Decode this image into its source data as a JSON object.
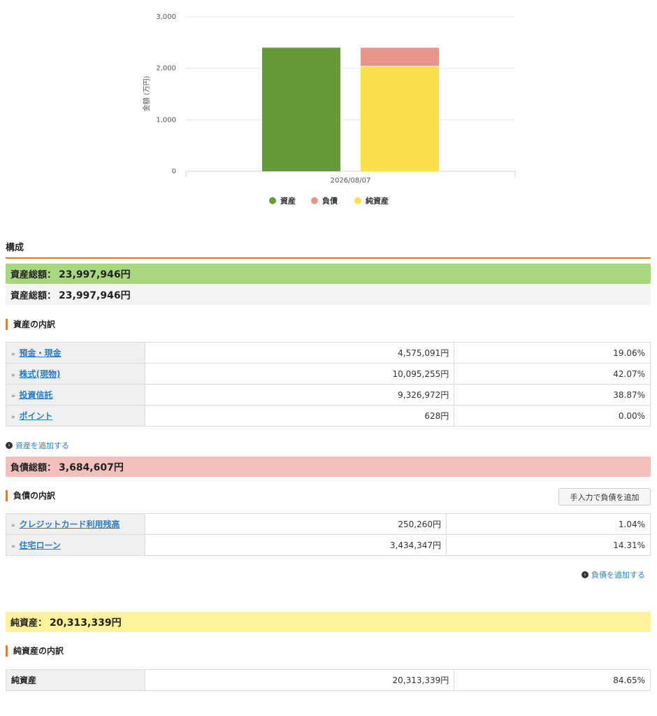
{
  "chart_data": {
    "type": "bar",
    "categories": [
      "2026/08/07"
    ],
    "series": [
      {
        "name": "資産",
        "values": [
          2400
        ],
        "color": "#67983a",
        "stack": "a"
      },
      {
        "name": "負債",
        "values": [
          368
        ],
        "color": "#e8968c",
        "stack": "b"
      },
      {
        "name": "純資産",
        "values": [
          2031
        ],
        "color": "#fbe04d",
        "stack": "b"
      }
    ],
    "title": "",
    "xlabel": "",
    "ylabel": "金額 (万円)",
    "ylim": [
      0,
      3000
    ],
    "yticks": [
      "0",
      "1,000",
      "2,000",
      "3,000"
    ],
    "grid": true,
    "legend": "bottom"
  },
  "composition": {
    "title": "構成",
    "asset_total_label": "資産総額：",
    "asset_total_value": "23,997,946円",
    "asset_total_label2": "資産総額：",
    "asset_total_value2": "23,997,946円",
    "asset_breakdown_title": "資産の内訳",
    "assets": [
      {
        "name": "預金・現金",
        "amount": "4,575,091円",
        "pct": "19.06%"
      },
      {
        "name": "株式(現物)",
        "amount": "10,095,255円",
        "pct": "42.07%"
      },
      {
        "name": "投資信託",
        "amount": "9,326,972円",
        "pct": "38.87%"
      },
      {
        "name": "ポイント",
        "amount": "628円",
        "pct": "0.00%"
      }
    ],
    "add_asset": "資産を追加する",
    "liability_total_label": "負債総額：",
    "liability_total_value": "3,684,607円",
    "liability_breakdown_title": "負債の内訳",
    "manual_add_button": "手入力で負債を追加",
    "liabilities": [
      {
        "name": "クレジットカード利用残高",
        "amount": "250,260円",
        "pct": "1.04%"
      },
      {
        "name": "住宅ローン",
        "amount": "3,434,347円",
        "pct": "14.31%"
      }
    ],
    "add_liability": "負債を追加する",
    "net_total_label": "純資産：",
    "net_total_value": "20,313,339円",
    "net_breakdown_title": "純資産の内訳",
    "net": [
      {
        "name": "純資産",
        "amount": "20,313,339円",
        "pct": "84.65%"
      }
    ],
    "expand_glyph": "»"
  }
}
